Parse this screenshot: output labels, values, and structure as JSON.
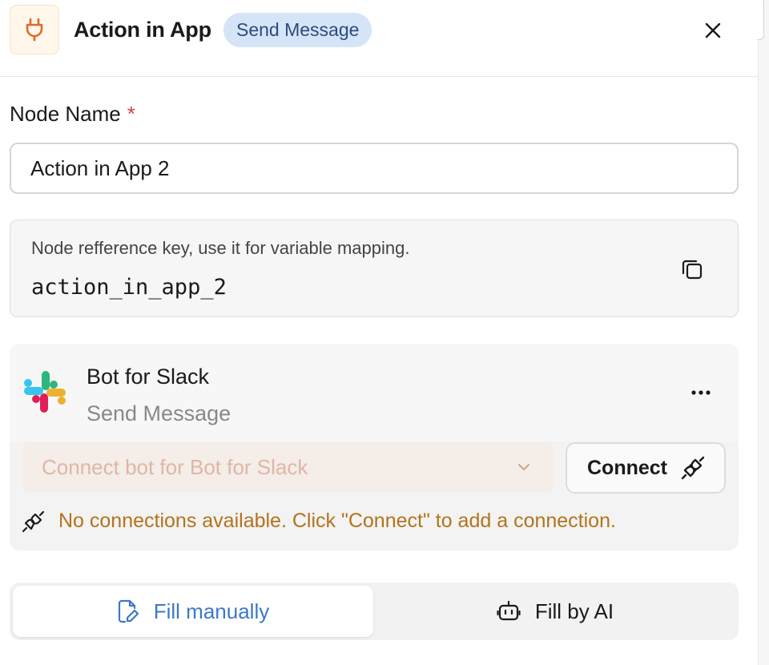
{
  "header": {
    "title": "Action in App",
    "badge": "Send Message",
    "icon": "plug-icon",
    "close_icon": "close-icon"
  },
  "node_name": {
    "label": "Node Name",
    "required_mark": "*",
    "value": "Action in App 2"
  },
  "reference": {
    "hint": "Node refference key, use it for variable mapping.",
    "key": "action_in_app_2",
    "copy_icon": "copy-icon"
  },
  "connection": {
    "app_name": "Bot for Slack",
    "action": "Send Message",
    "logo": "slack-logo",
    "select_placeholder": "Connect bot for Bot for Slack",
    "connect_label": "Connect",
    "warning": "No connections available. Click \"Connect\" to add a connection."
  },
  "fill_tabs": {
    "manual_label": "Fill manually",
    "ai_label": "Fill by AI",
    "active": "manual"
  },
  "colors": {
    "accent_blue": "#3d78c9",
    "badge_bg": "#d6e4f7",
    "warning": "#b4731c",
    "required": "#d0453a",
    "plug_orange": "#e06a2c"
  }
}
